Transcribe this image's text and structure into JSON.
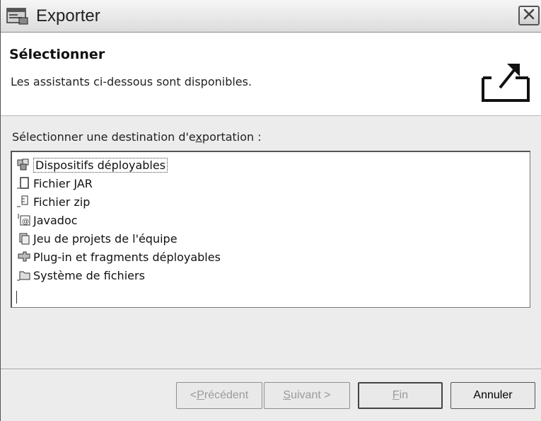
{
  "window": {
    "title": "Exporter"
  },
  "header": {
    "title": "Sélectionner",
    "description": "Les assistants ci-dessous sont disponibles."
  },
  "list": {
    "label_prefix": "Sélectionner une destination d'e",
    "label_mnemonic": "x",
    "label_suffix": "portation :",
    "items": [
      {
        "label": "Dispositifs déployables",
        "icon": "deployable-icon",
        "selected": true
      },
      {
        "label": "Fichier JAR",
        "icon": "jar-file-icon"
      },
      {
        "label": "Fichier zip",
        "icon": "zip-file-icon"
      },
      {
        "label": "Javadoc",
        "icon": "javadoc-icon"
      },
      {
        "label": "Jeu de projets de l'équipe",
        "icon": "team-project-set-icon"
      },
      {
        "label": "Plug-in et fragments déployables",
        "icon": "plugin-icon"
      },
      {
        "label": "Système de fichiers",
        "icon": "folder-icon"
      }
    ]
  },
  "buttons": {
    "back_prefix": "< ",
    "back_mnemonic": "P",
    "back_rest": "récédent",
    "next_mnemonic": "S",
    "next_rest": "uivant >",
    "finish_mnemonic": "F",
    "finish_rest": "in",
    "cancel": "Annuler"
  },
  "colors": {
    "window_bg": "#ececec",
    "panel_bg": "#ffffff",
    "disabled_text": "#9a9a9a"
  }
}
